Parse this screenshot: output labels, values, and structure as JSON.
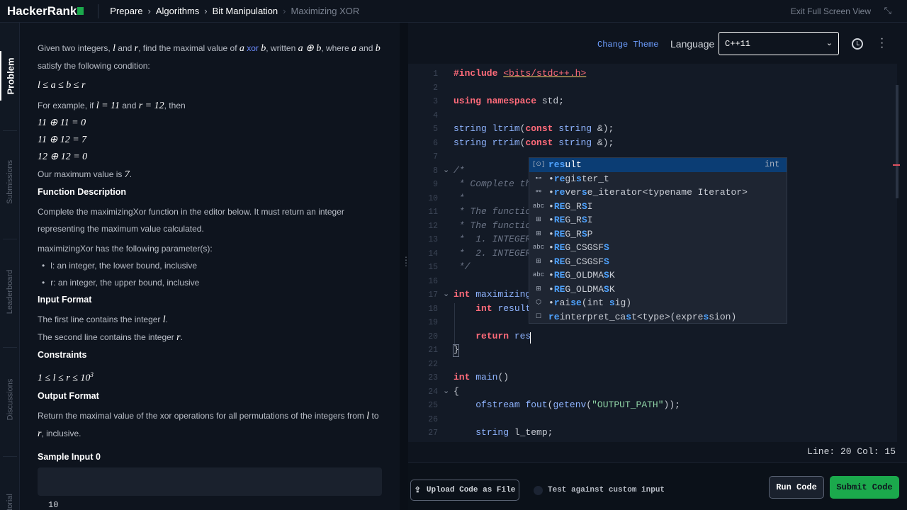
{
  "header": {
    "logo": "HackerRank",
    "breadcrumbs": [
      "Prepare",
      "Algorithms",
      "Bit Manipulation",
      "Maximizing XOR"
    ],
    "exit_fullscreen": "Exit Full Screen View"
  },
  "sidebar": {
    "tabs": [
      "Problem",
      "Submissions",
      "Leaderboard",
      "Discussions",
      "Editorial"
    ]
  },
  "problem": {
    "intro_1": "Given two integers,",
    "intro_and": "and",
    "intro_2": ", find the maximal value of",
    "xor_word": "xor",
    "intro_3": ", written",
    "intro_4": ", where",
    "intro_5": "satisfy the following condition:",
    "var_l": "l",
    "var_r": "r",
    "var_a": "a",
    "var_b": "b",
    "expr_aoplusb": "a ⊕ b",
    "condition": "l ≤ a ≤ b ≤ r",
    "example_1": "For example, if",
    "example_l": "l = 11",
    "example_r": "r = 12",
    "example_then": ", then",
    "example_lines": [
      "11 ⊕ 11 = 0",
      "11 ⊕ 12 = 7",
      "12 ⊕ 12 = 0"
    ],
    "max_text": "Our maximum value is",
    "max_value": "7",
    "func_desc_title": "Function Description",
    "func_desc_text": "Complete the maximizingXor function in the editor below. It must return an integer representing the maximum value calculated.",
    "params_intro": "maximizingXor has the following parameter(s):",
    "params": [
      "l: an integer, the lower bound, inclusive",
      "r: an integer, the upper bound, inclusive"
    ],
    "input_format_title": "Input Format",
    "input_line_1": "The first line contains the integer",
    "input_line_2": "The second line contains the integer",
    "constraints_title": "Constraints",
    "constraint": "1 ≤ l ≤ r ≤ 10",
    "constraint_exp": "3",
    "output_format_title": "Output Format",
    "output_text_1": "Return the maximal value of the xor operations for all permutations of the integers from",
    "output_to": "to",
    "output_text_2": "inclusive.",
    "sample_input_title": "Sample Input 0",
    "sample_input_value": "10"
  },
  "editor": {
    "change_theme": "Change Theme",
    "language_label": "Language",
    "language_value": "C++11",
    "status": "Line: 20 Col: 15",
    "lines": [
      {
        "n": "1",
        "html": "<span class=\"k\">#include</span> <span class=\"inc\">&lt;bits/stdc++.h&gt;</span>"
      },
      {
        "n": "2",
        "html": ""
      },
      {
        "n": "3",
        "html": "<span class=\"k\">using namespace</span> std;"
      },
      {
        "n": "4",
        "html": ""
      },
      {
        "n": "5",
        "html": "<span class=\"t\">string</span> <span class=\"f\">ltrim</span>(<span class=\"k\">const</span> <span class=\"t\">string</span> &amp;);"
      },
      {
        "n": "6",
        "html": "<span class=\"t\">string</span> <span class=\"f\">rtrim</span>(<span class=\"k\">const</span> <span class=\"t\">string</span> &amp;);"
      },
      {
        "n": "7",
        "html": ""
      },
      {
        "n": "8",
        "html": "<span class=\"c\">/*</span>",
        "fold": true
      },
      {
        "n": "9",
        "html": "<span class=\"c\"> * Complete th</span>"
      },
      {
        "n": "10",
        "html": "<span class=\"c\"> *</span>"
      },
      {
        "n": "11",
        "html": "<span class=\"c\"> * The functio</span>"
      },
      {
        "n": "12",
        "html": "<span class=\"c\"> * The functio</span>"
      },
      {
        "n": "13",
        "html": "<span class=\"c\"> *  1. INTEGER</span>"
      },
      {
        "n": "14",
        "html": "<span class=\"c\"> *  2. INTEGER</span>"
      },
      {
        "n": "15",
        "html": "<span class=\"c\"> */</span>"
      },
      {
        "n": "16",
        "html": ""
      },
      {
        "n": "17",
        "html": "<span class=\"k\">int</span> <span class=\"t\">maximizing</span>",
        "fold": true
      },
      {
        "n": "18",
        "html": "    <span class=\"k\">int</span> <span class=\"t\">result</span>"
      },
      {
        "n": "19",
        "html": ""
      },
      {
        "n": "20",
        "html": "    <span class=\"k\">return</span> <span class=\"t\">res</span>"
      },
      {
        "n": "21",
        "html": "}"
      },
      {
        "n": "22",
        "html": ""
      },
      {
        "n": "23",
        "html": "<span class=\"k\">int</span> <span class=\"f\">main</span>()"
      },
      {
        "n": "24",
        "html": "{",
        "fold": true
      },
      {
        "n": "25",
        "html": "    <span class=\"t\">ofstream</span> <span class=\"f\">fout</span>(<span class=\"f\">getenv</span>(<span class=\"s\">\"OUTPUT_PATH\"</span>));"
      },
      {
        "n": "26",
        "html": ""
      },
      {
        "n": "27",
        "html": "    <span class=\"t\">string</span> l_temp;"
      }
    ]
  },
  "autocomplete": {
    "items": [
      {
        "icon": "[⊙]",
        "html": "<span class=\"hl\">res</span>ult",
        "type": "int",
        "selected": true
      },
      {
        "icon": "⊷",
        "html": "•<span class=\"hl\">re</span>gi<span class=\"hl\">s</span>ter_t",
        "type": ""
      },
      {
        "icon": "⚯",
        "html": "•<span class=\"hl\">re</span>ver<span class=\"hl\">s</span>e_iterator&lt;typename Iterator&gt;",
        "type": ""
      },
      {
        "icon": "abc",
        "html": "•<span class=\"hl\">RE</span>G_R<span class=\"hl\">S</span>I",
        "type": ""
      },
      {
        "icon": "⊞",
        "html": "•<span class=\"hl\">RE</span>G_R<span class=\"hl\">S</span>I",
        "type": ""
      },
      {
        "icon": "⊞",
        "html": "•<span class=\"hl\">RE</span>G_R<span class=\"hl\">S</span>P",
        "type": ""
      },
      {
        "icon": "abc",
        "html": "•<span class=\"hl\">RE</span>G_CSGSF<span class=\"hl\">S</span>",
        "type": ""
      },
      {
        "icon": "⊞",
        "html": "•<span class=\"hl\">RE</span>G_CSGSF<span class=\"hl\">S</span>",
        "type": ""
      },
      {
        "icon": "abc",
        "html": "•<span class=\"hl\">RE</span>G_OLDMA<span class=\"hl\">S</span>K",
        "type": ""
      },
      {
        "icon": "⊞",
        "html": "•<span class=\"hl\">RE</span>G_OLDMA<span class=\"hl\">S</span>K",
        "type": ""
      },
      {
        "icon": "⬡",
        "html": "•<span class=\"hl\">r</span>ai<span class=\"hl\">se</span>(int <span class=\"hl\">s</span>ig)",
        "type": ""
      },
      {
        "icon": "☐",
        "html": " <span class=\"hl\">re</span>interpret_ca<span class=\"hl\">s</span>t&lt;type&gt;(expre<span class=\"hl\">s</span>sion)",
        "type": ""
      }
    ]
  },
  "bottom": {
    "upload": "Upload Code as File",
    "custom_input": "Test against custom input",
    "run": "Run Code",
    "submit": "Submit Code"
  }
}
